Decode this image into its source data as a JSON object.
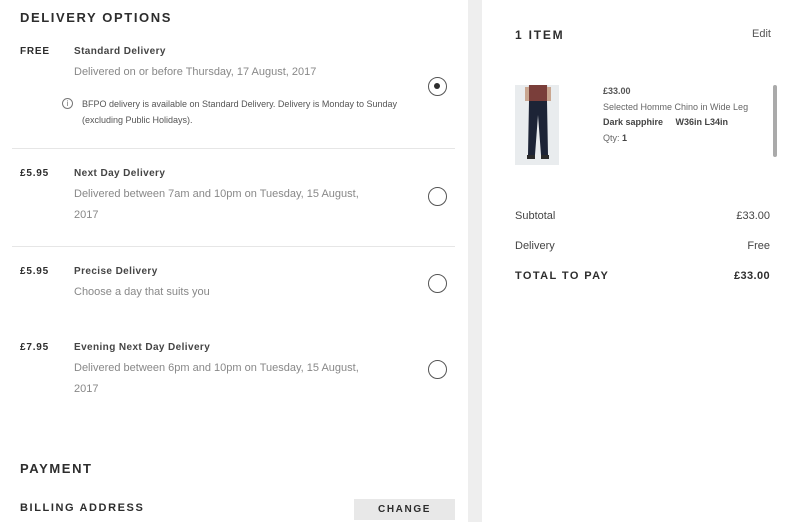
{
  "delivery": {
    "title": "DELIVERY OPTIONS",
    "options": [
      {
        "price": "FREE",
        "name": "Standard Delivery",
        "description": "Delivered on or before Thursday, 17 August, 2017",
        "info": "BFPO delivery is available on Standard Delivery. Delivery is Monday to Sunday (excluding Public Holidays).",
        "selected": true
      },
      {
        "price": "£5.95",
        "name": "Next Day Delivery",
        "description": "Delivered between 7am and 10pm on Tuesday, 15 August, 2017",
        "selected": false
      },
      {
        "price": "£5.95",
        "name": "Precise Delivery",
        "description": "Choose a day that suits you",
        "selected": false
      },
      {
        "price": "£7.95",
        "name": "Evening Next Day Delivery",
        "description": "Delivered between 6pm and 10pm on Tuesday, 15 August, 2017",
        "selected": false
      }
    ]
  },
  "payment": {
    "title": "PAYMENT",
    "billing_label": "BILLING ADDRESS",
    "change_label": "CHANGE"
  },
  "bag": {
    "title": "1 ITEM",
    "edit_label": "Edit",
    "item": {
      "price": "£33.00",
      "name": "Selected Homme Chino in Wide Leg",
      "colour": "Dark sapphire",
      "size": "W36in L34in",
      "qty_label": "Qty:",
      "qty": "1"
    },
    "summary": {
      "subtotal_label": "Subtotal",
      "subtotal_value": "£33.00",
      "delivery_label": "Delivery",
      "delivery_value": "Free",
      "total_label": "TOTAL TO PAY",
      "total_value": "£33.00"
    }
  }
}
